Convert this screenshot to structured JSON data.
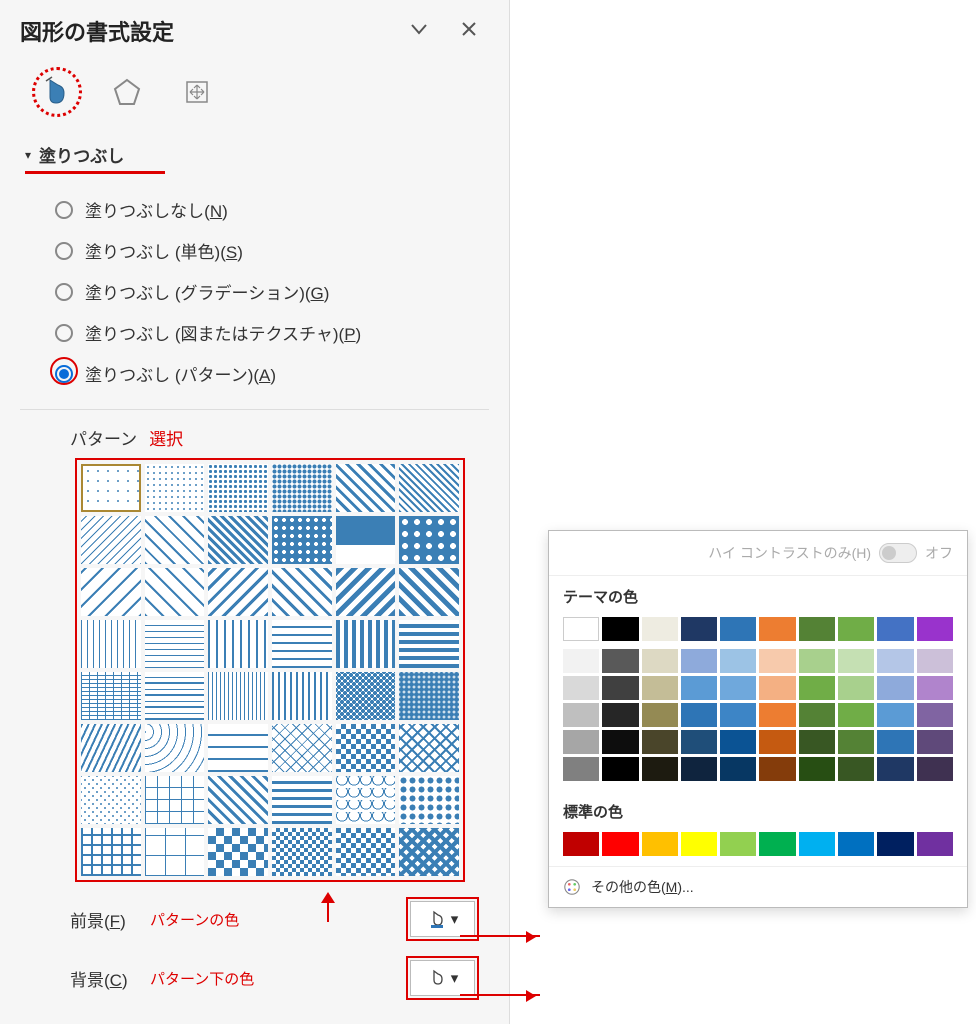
{
  "pane": {
    "title": "図形の書式設定",
    "section": "塗りつぶし"
  },
  "fill_options": {
    "none": "塗りつぶしなし(",
    "none_ul": "N",
    "solid": "塗りつぶし (単色)(",
    "solid_ul": "S",
    "grad": "塗りつぶし (グラデーション)(",
    "grad_ul": "G",
    "pict": "塗りつぶし (図またはテクスチャ)(",
    "pict_ul": "P",
    "patt": "塗りつぶし (パターン)(",
    "patt_ul": "A"
  },
  "pattern": {
    "label": "パターン",
    "annotation": "選択"
  },
  "fg": {
    "label": "前景(",
    "ul": "F",
    "annotation": "パターンの色"
  },
  "bg": {
    "label": "背景(",
    "ul": "C",
    "annotation": "パターン下の色"
  },
  "popup": {
    "hc_label": "ハイ コントラストのみ(H)",
    "hc_state": "オフ",
    "theme_title": "テーマの色",
    "standard_title": "標準の色",
    "more_label": "その他の色(",
    "more_ul": "M",
    "more_suffix": ")..."
  },
  "colors": {
    "theme": [
      "#ffffff",
      "#000000",
      "#eeece1",
      "#1f3864",
      "#2e75b6",
      "#ed7d31",
      "#548235",
      "#70ad47",
      "#4472c4",
      "#9933cc"
    ],
    "theme_shades": [
      [
        "#f2f2f2",
        "#595959",
        "#ddd9c3",
        "#8eaadb",
        "#9cc3e5",
        "#f7caac",
        "#a8d08d",
        "#c5e0b3",
        "#b4c6e7",
        "#ccc0d9"
      ],
      [
        "#d9d9d9",
        "#404040",
        "#c4bd97",
        "#5b9bd5",
        "#6fa8dc",
        "#f4b083",
        "#70ad47",
        "#a8d08d",
        "#8eaadb",
        "#b084cc"
      ],
      [
        "#bfbfbf",
        "#262626",
        "#948a54",
        "#2e75b6",
        "#3d85c6",
        "#ed7d31",
        "#548235",
        "#70ad47",
        "#5b9bd5",
        "#8064a2"
      ],
      [
        "#a6a6a6",
        "#0d0d0d",
        "#4a452a",
        "#1f4e79",
        "#0b5394",
        "#c55a11",
        "#385723",
        "#548235",
        "#2e75b6",
        "#5f497a"
      ],
      [
        "#808080",
        "#000000",
        "#1d1b10",
        "#0f243e",
        "#073763",
        "#843c0b",
        "#274e13",
        "#385723",
        "#1f3864",
        "#3f3151"
      ]
    ],
    "standard": [
      "#c00000",
      "#ff0000",
      "#ffc000",
      "#ffff00",
      "#92d050",
      "#00b050",
      "#00b0f0",
      "#0070c0",
      "#002060",
      "#7030a0"
    ]
  }
}
